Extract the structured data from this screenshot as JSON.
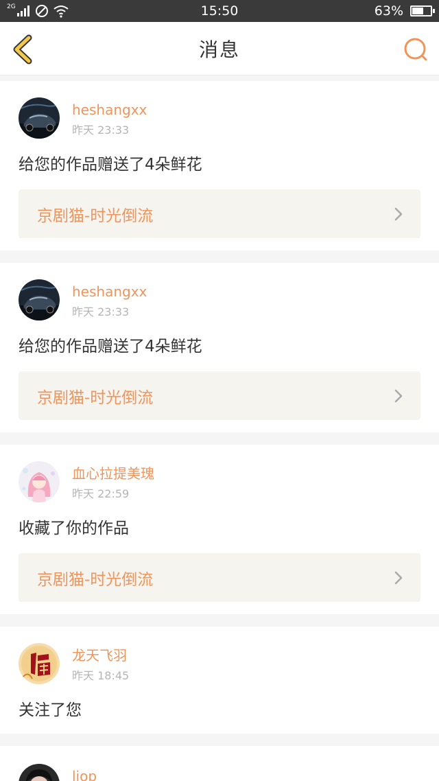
{
  "status_bar": {
    "network": "2G",
    "time": "15:50",
    "battery": "63%",
    "battery_level": 0.63
  },
  "header": {
    "title": "消息",
    "back_icon": "chevron-left-icon",
    "search_icon": "search-icon"
  },
  "colors": {
    "accent": "#f0945a",
    "back_icon": "#f2c94c"
  },
  "messages": [
    {
      "user": "heshangxx",
      "time": "昨天 23:33",
      "action": "给您的作品赠送了4朵鲜花",
      "work": "京剧猫-时光倒流",
      "avatar": "car-avatar"
    },
    {
      "user": "heshangxx",
      "time": "昨天 23:33",
      "action": "给您的作品赠送了4朵鲜花",
      "work": "京剧猫-时光倒流",
      "avatar": "car-avatar"
    },
    {
      "user": "血心拉提美瑰",
      "time": "昨天 22:59",
      "action": "收藏了你的作品",
      "work": "京剧猫-时光倒流",
      "avatar": "anime-girl-avatar"
    },
    {
      "user": "龙天飞羽",
      "time": "昨天 18:45",
      "action": "关注了您",
      "avatar": "fu-character-avatar"
    },
    {
      "user": "liop",
      "avatar": "person-avatar"
    }
  ]
}
